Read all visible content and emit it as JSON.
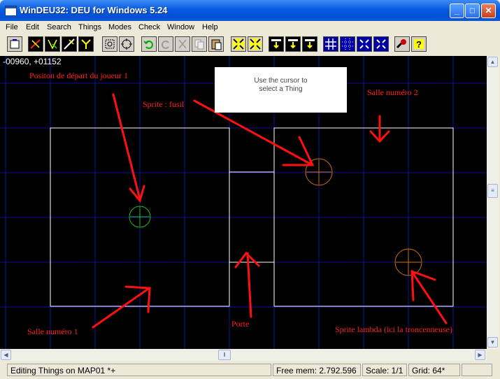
{
  "window": {
    "title": "WinDEU32: DEU for Windows 5.24"
  },
  "menu": [
    "File",
    "Edit",
    "Search",
    "Things",
    "Modes",
    "Check",
    "Window",
    "Help"
  ],
  "toolbar_icons": [
    "open-icon",
    "linedef-icon",
    "sector-icon",
    "vertex-icon",
    "thing-icon",
    "zoom-fit-icon",
    "center-icon",
    "undo-icon",
    "redo-icon",
    "cut-icon",
    "copy-icon",
    "paste-icon",
    "grid-shrink-icon",
    "grid-expand-icon",
    "insert-icon",
    "delete-icon",
    "info-icon",
    "grid-icon",
    "grid-dots-icon",
    "zoom-in-icon",
    "zoom-out-icon",
    "help-tool-icon",
    "help-icon"
  ],
  "map": {
    "coordinates": "-00960, +01152",
    "message": {
      "line1": "Use the cursor to",
      "line2": "select a Thing"
    }
  },
  "annotations": {
    "player_start": "Positon de départ du joueur 1",
    "sprite_fusil": "Sprite : fusil",
    "salle2": "Salle numéro 2",
    "salle1": "Salle numéro 1",
    "porte": "Porte",
    "sprite_lambda": "Sprite lambda (ici la troncenneuse)"
  },
  "status": {
    "mode": "Editing Things on MAP01 *+",
    "mem": "Free mem: 2.792.596",
    "scale": "Scale: 1/1",
    "grid": "Grid: 64*"
  },
  "colors": {
    "player_thing": "#20c020",
    "item_thing": "#d07010",
    "annotation": "#ff2020",
    "grid": "#1010a0"
  }
}
